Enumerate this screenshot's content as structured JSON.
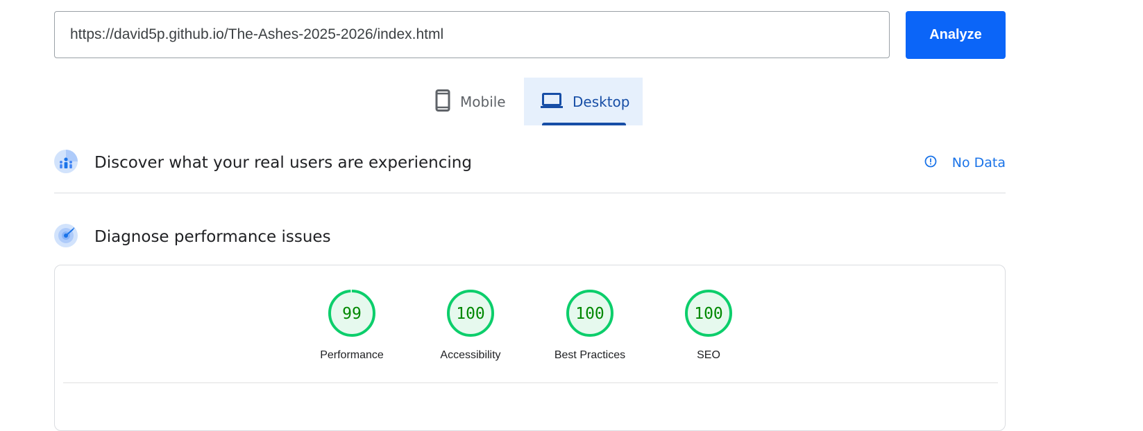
{
  "url_bar": {
    "value": "https://david5p.github.io/The-Ashes-2025-2026/index.html",
    "analyze_label": "Analyze"
  },
  "device_tabs": {
    "mobile_label": "Mobile",
    "desktop_label": "Desktop",
    "selected": "Desktop"
  },
  "field_data": {
    "title": "Discover what your real users are experiencing",
    "status_label": "No Data"
  },
  "lab_data": {
    "title": "Diagnose performance issues",
    "scores": [
      {
        "label": "Performance",
        "score": 99
      },
      {
        "label": "Accessibility",
        "score": 100
      },
      {
        "label": "Best Practices",
        "score": 100
      },
      {
        "label": "SEO",
        "score": 100
      }
    ]
  },
  "colors": {
    "accent": "#0b65f8",
    "pass_ring": "#0cce6b",
    "pass_fill": "#e6f9ee",
    "pass_text": "#008800",
    "tab_selected_bg": "#e6f0fc",
    "tab_selected_text": "#174ea6"
  }
}
